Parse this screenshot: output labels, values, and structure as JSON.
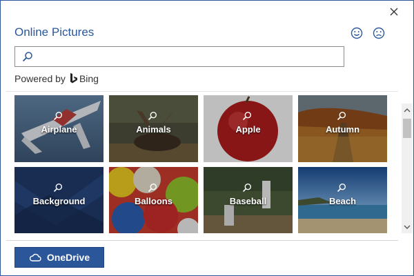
{
  "dialog": {
    "title": "Online Pictures",
    "close_icon": "close-icon",
    "feedback": {
      "smile_icon": "smile-icon",
      "frown_icon": "frown-icon"
    }
  },
  "search": {
    "value": "",
    "placeholder": "",
    "icon": "search-icon"
  },
  "powered": {
    "prefix": "Powered by",
    "brand": "Bing",
    "brand_icon": "bing-logo-icon"
  },
  "tiles": [
    {
      "label": "Airplane"
    },
    {
      "label": "Animals"
    },
    {
      "label": "Apple"
    },
    {
      "label": "Autumn"
    },
    {
      "label": "Background"
    },
    {
      "label": "Balloons"
    },
    {
      "label": "Baseball"
    },
    {
      "label": "Beach"
    }
  ],
  "footer": {
    "onedrive_label": "OneDrive",
    "onedrive_icon": "cloud-icon"
  },
  "colors": {
    "accent": "#2b579a",
    "button_bg": "#2b579a",
    "button_text": "#ffffff"
  }
}
